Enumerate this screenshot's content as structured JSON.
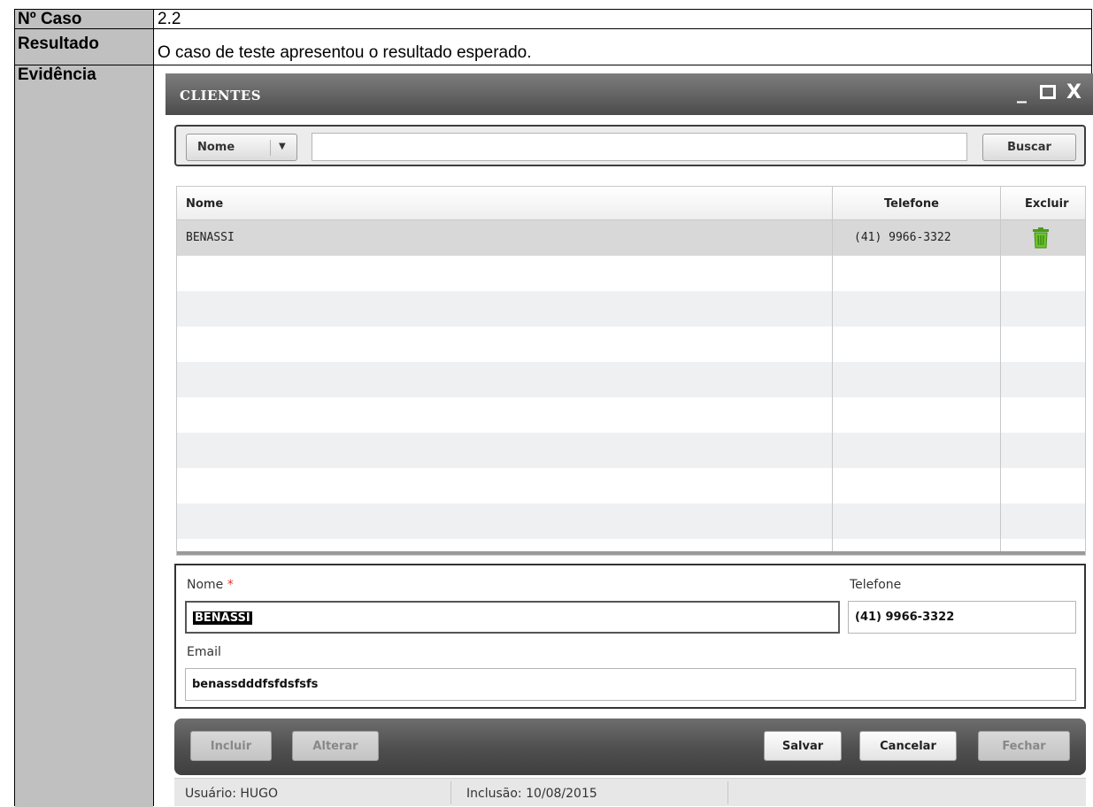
{
  "doc": {
    "case_label": "Nº Caso",
    "case_value": "2.2",
    "result_label": "Resultado",
    "result_value": "O caso de teste apresentou o resultado esperado.",
    "evidence_label": "Evidência"
  },
  "window": {
    "title": "CLIENTES",
    "minimize": "_",
    "maximize": "□",
    "close": "X"
  },
  "search": {
    "field_select": "Nome",
    "field_arrow": "▼",
    "input_value": "",
    "button": "Buscar"
  },
  "grid": {
    "columns": [
      "Nome",
      "Telefone",
      "Excluir"
    ],
    "rows": [
      {
        "nome": "BENASSI",
        "telefone": "(41) 9966-3322",
        "excluir_icon": "trash-icon"
      }
    ]
  },
  "form": {
    "nome_label": "Nome",
    "required_mark": "*",
    "nome_value": "BENASSI",
    "telefone_label": "Telefone",
    "telefone_value": "(41) 9966-3322",
    "email_label": "Email",
    "email_value": "benassdddfsfdsfsfs"
  },
  "buttons": {
    "incluir": "Incluir",
    "alterar": "Alterar",
    "salvar": "Salvar",
    "cancelar": "Cancelar",
    "fechar": "Fechar"
  },
  "status": {
    "usuario": "Usuário: HUGO",
    "inclusao": "Inclusão: 10/08/2015"
  },
  "colors": {
    "doc_label_bg": "#c0c0c0",
    "title_bar": "#5a5a5a",
    "trash_icon": "#6cc52a",
    "required": "#e53030"
  }
}
